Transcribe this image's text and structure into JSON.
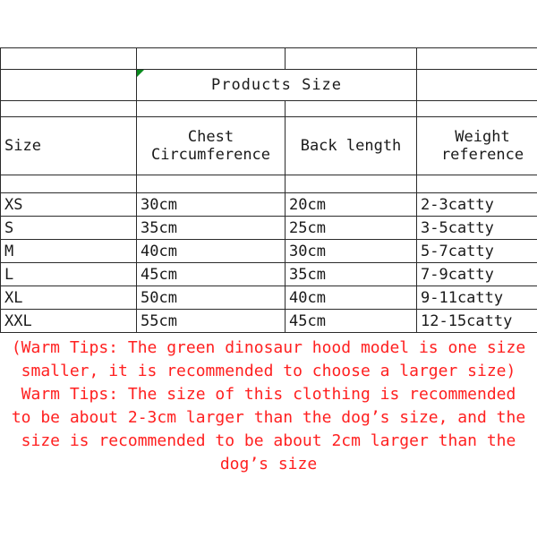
{
  "table": {
    "title": "Products Size",
    "comment_marker_color": "#0a8a1e",
    "title_color": "#ff0000",
    "grid_color": "#2b2b2b",
    "columns": [
      "Size",
      "Chest Circumference",
      "Back length",
      "Weight reference"
    ],
    "headers": {
      "size": "Size",
      "chest_line1": "Chest",
      "chest_line2": "Circumference",
      "back": "Back length",
      "weight_line1": "Weight",
      "weight_line2": "reference"
    },
    "rows": [
      {
        "size": "XS",
        "chest": "30cm",
        "back": "20cm",
        "weight": "2-3catty"
      },
      {
        "size": "S",
        "chest": "35cm",
        "back": "25cm",
        "weight": "3-5catty"
      },
      {
        "size": "M",
        "chest": "40cm",
        "back": "30cm",
        "weight": "5-7catty"
      },
      {
        "size": "L",
        "chest": "45cm",
        "back": "35cm",
        "weight": "7-9catty"
      },
      {
        "size": "XL",
        "chest": "50cm",
        "back": "40cm",
        "weight": "9-11catty"
      },
      {
        "size": "XXL",
        "chest": "55cm",
        "back": "45cm",
        "weight": "12-15catty"
      }
    ]
  },
  "notes": {
    "warm_tips_color": "#ff2020",
    "warm_tips": "(Warm Tips: The green dinosaur hood model is one size smaller, it is recommended to choose a larger size) Warm Tips: The size of this clothing is recommended to be about 2-3cm larger than the dog’s size, and the size is recommended to be about 2cm larger than the dog’s size"
  }
}
